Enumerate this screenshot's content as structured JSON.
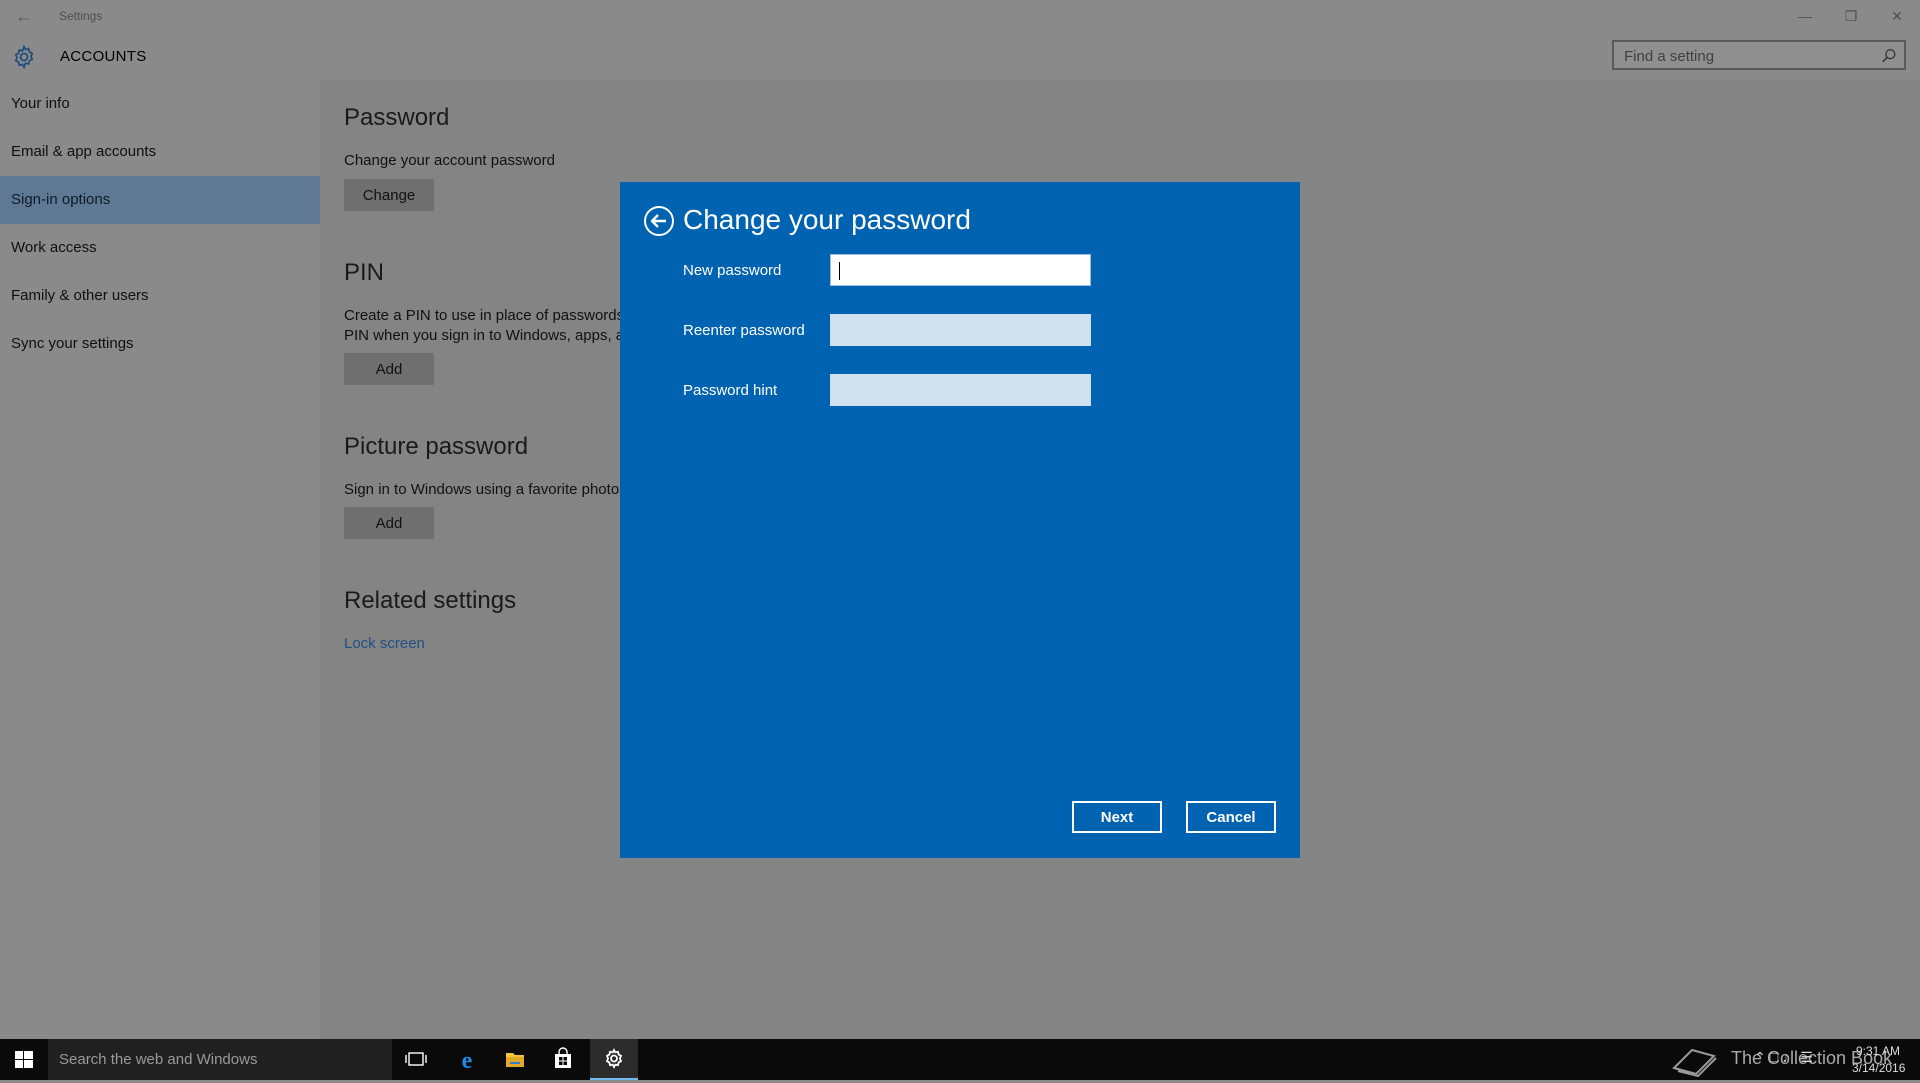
{
  "window": {
    "title": "Settings",
    "back_icon": "arrow-left-icon",
    "controls": [
      "minimize-icon",
      "restore-icon",
      "close-icon"
    ]
  },
  "header": {
    "section_title": "ACCOUNTS",
    "icon": "gear-icon",
    "search_placeholder": "Find a setting"
  },
  "sidebar": {
    "items": [
      {
        "label": "Your info",
        "active": false
      },
      {
        "label": "Email & app accounts",
        "active": false
      },
      {
        "label": "Sign-in options",
        "active": true
      },
      {
        "label": "Work access",
        "active": false
      },
      {
        "label": "Family & other users",
        "active": false
      },
      {
        "label": "Sync your settings",
        "active": false
      }
    ],
    "active_color": "#5f7994"
  },
  "main": {
    "password": {
      "heading": "Password",
      "description": "Change your account password",
      "button": "Change"
    },
    "pin": {
      "heading": "PIN",
      "description_line1": "Create a PIN to use in place of passwords.",
      "description_line2": "PIN when you sign in to Windows, apps, a",
      "button": "Add"
    },
    "picture_password": {
      "heading": "Picture password",
      "description": "Sign in to Windows using a favorite photo",
      "button": "Add"
    },
    "related": {
      "heading": "Related settings",
      "link": "Lock screen"
    }
  },
  "dialog": {
    "title": "Change your password",
    "back_icon": "circle-arrow-left-icon",
    "fields": [
      {
        "label": "New password",
        "value": "",
        "focused": true
      },
      {
        "label": "Reenter password",
        "value": "",
        "focused": false
      },
      {
        "label": "Password hint",
        "value": "",
        "focused": false
      }
    ],
    "next_label": "Next",
    "cancel_label": "Cancel",
    "background_color": "#0063b1"
  },
  "taskbar": {
    "search_text": "Search the web and Windows",
    "pinned": [
      "task-view-icon",
      "edge-icon",
      "file-explorer-icon",
      "store-icon",
      "settings-icon"
    ],
    "watermark": "The Collection Book",
    "time": "9:31 AM",
    "date": "3/14/2016"
  }
}
